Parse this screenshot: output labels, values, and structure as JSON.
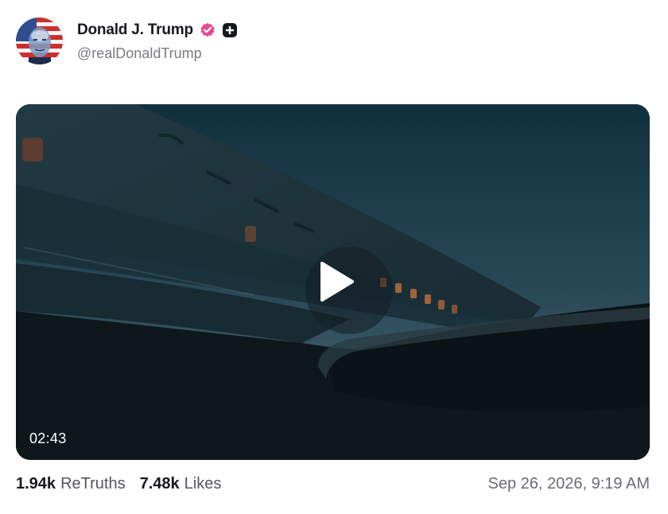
{
  "post": {
    "author_name": "Donald J. Trump",
    "handle": "@realDonaldTrump",
    "verified_icon": "verified-badge-icon",
    "plus_icon": "plus-badge-icon",
    "accent_color": "#e7488e",
    "video": {
      "duration": "02:43",
      "play_icon": "play-icon"
    },
    "stats": {
      "retruths_count": "1.94k",
      "retruths_label": "ReTruths",
      "likes_count": "7.48k",
      "likes_label": "Likes"
    },
    "timestamp": "Sep 26, 2026, 9:19 AM"
  }
}
